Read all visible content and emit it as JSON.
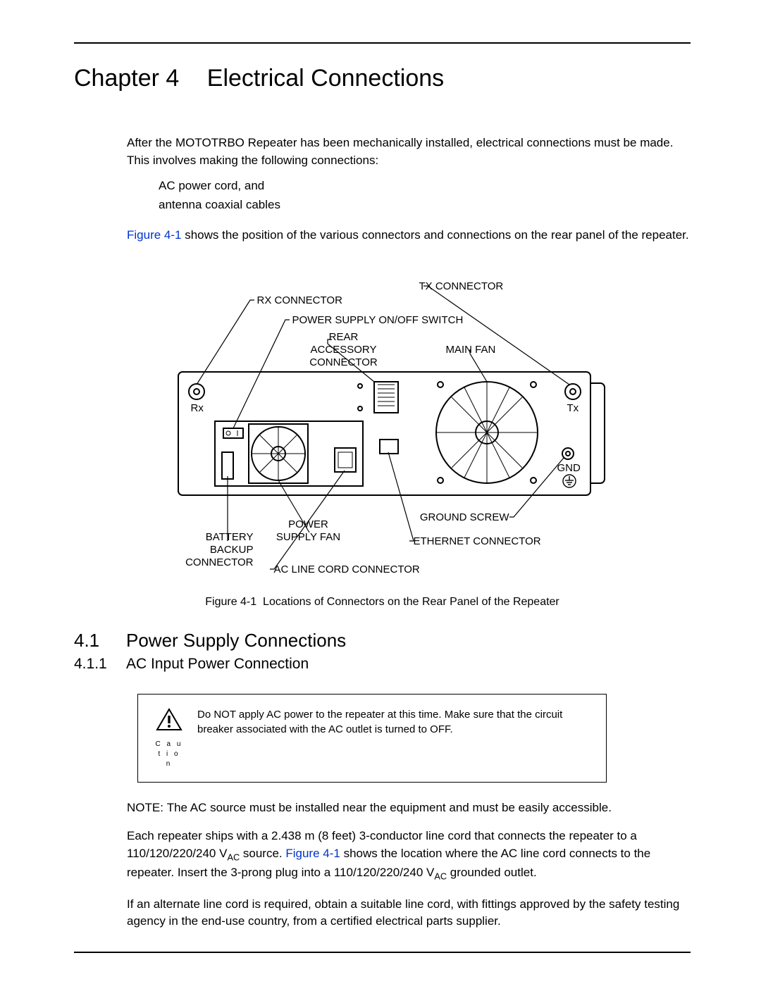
{
  "chapter": {
    "label": "Chapter 4",
    "title": "Electrical Connections"
  },
  "intro": {
    "p1": "After the MOTOTRBO Repeater has been mechanically installed, electrical connections must be made. This involves making the following connections:",
    "items": [
      "AC power cord, and",
      "antenna coaxial cables"
    ],
    "p2_linktext": "Figure 4-1",
    "p2_rest": " shows the position of the various connectors and connections on the rear panel of the repeater."
  },
  "figure": {
    "caption_label": "Figure 4-1",
    "caption_text": "Locations of Connectors on the Rear Panel of the Repeater",
    "labels": {
      "rx_connector": "RX CONNECTOR",
      "power_switch": "POWER SUPPLY ON/OFF SWITCH",
      "rear_accessory_1": "REAR",
      "rear_accessory_2": "ACCESSORY",
      "rear_accessory_3": "CONNECTOR",
      "tx_connector": "TX CONNECTOR",
      "main_fan": "MAIN FAN",
      "rx": "Rx",
      "tx": "Tx",
      "gnd": "GND",
      "ground_screw": "GROUND SCREW",
      "ethernet": "ETHERNET CONNECTOR",
      "ac_line": "AC LINE CORD CONNECTOR",
      "psu_fan_1": "POWER",
      "psu_fan_2": "SUPPLY FAN",
      "battery_1": "BATTERY",
      "battery_2": "BACKUP",
      "battery_3": "CONNECTOR"
    }
  },
  "sections": {
    "s41_num": "4.1",
    "s41_title": "Power Supply Connections",
    "s411_num": "4.1.1",
    "s411_title": "AC Input Power Connection"
  },
  "caution": {
    "label": "C a u t i o n",
    "text": "Do NOT apply AC power to the repeater at this time. Make sure that the circuit breaker associated with the AC outlet is turned to OFF."
  },
  "note": {
    "label": "NOTE:",
    "text": "The AC source must be installed near the equipment and must be easily accessible."
  },
  "body2": {
    "p1a": "Each repeater ships with a 2.438 m (8 feet) 3-conductor line cord that connects the repeater to a 110/120/220/240 V",
    "p1b": " source. ",
    "p1_link": "Figure 4-1",
    "p1c": " shows the location where the AC line cord connects to the repeater. Insert the 3-prong plug into a 110/120/220/240 V",
    "p1d": " grounded outlet.",
    "sub_ac": "AC",
    "p2": "If an alternate line cord is required, obtain a suitable line cord, with fittings approved by the safety testing agency in the end-use country, from a certified electrical parts supplier."
  }
}
